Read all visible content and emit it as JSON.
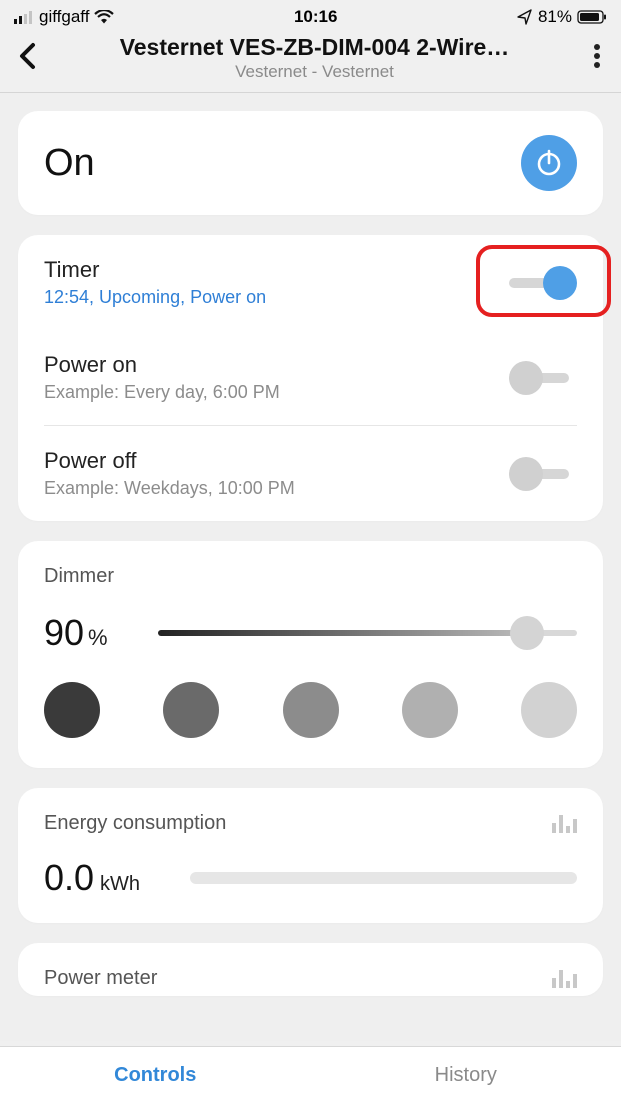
{
  "status": {
    "carrier": "giffgaff",
    "time": "10:16",
    "battery": "81%"
  },
  "header": {
    "title": "Vesternet VES-ZB-DIM-004 2-Wire…",
    "subtitle": "Vesternet - Vesternet"
  },
  "power": {
    "state": "On"
  },
  "schedule": {
    "timer": {
      "title": "Timer",
      "subtitle": "12:54, Upcoming, Power on",
      "on": true
    },
    "power_on": {
      "title": "Power on",
      "subtitle": "Example: Every day, 6:00 PM",
      "on": false
    },
    "power_off": {
      "title": "Power off",
      "subtitle": "Example: Weekdays, 10:00 PM",
      "on": false
    }
  },
  "dimmer": {
    "label": "Dimmer",
    "value": "90",
    "unit": "%",
    "presets": [
      "#3a3a3a",
      "#6a6a6a",
      "#8c8c8c",
      "#b0b0b0",
      "#d2d2d2"
    ]
  },
  "energy": {
    "label": "Energy consumption",
    "value": "0.0",
    "unit": "kWh"
  },
  "meter": {
    "label": "Power meter"
  },
  "tabs": {
    "controls": "Controls",
    "history": "History"
  }
}
